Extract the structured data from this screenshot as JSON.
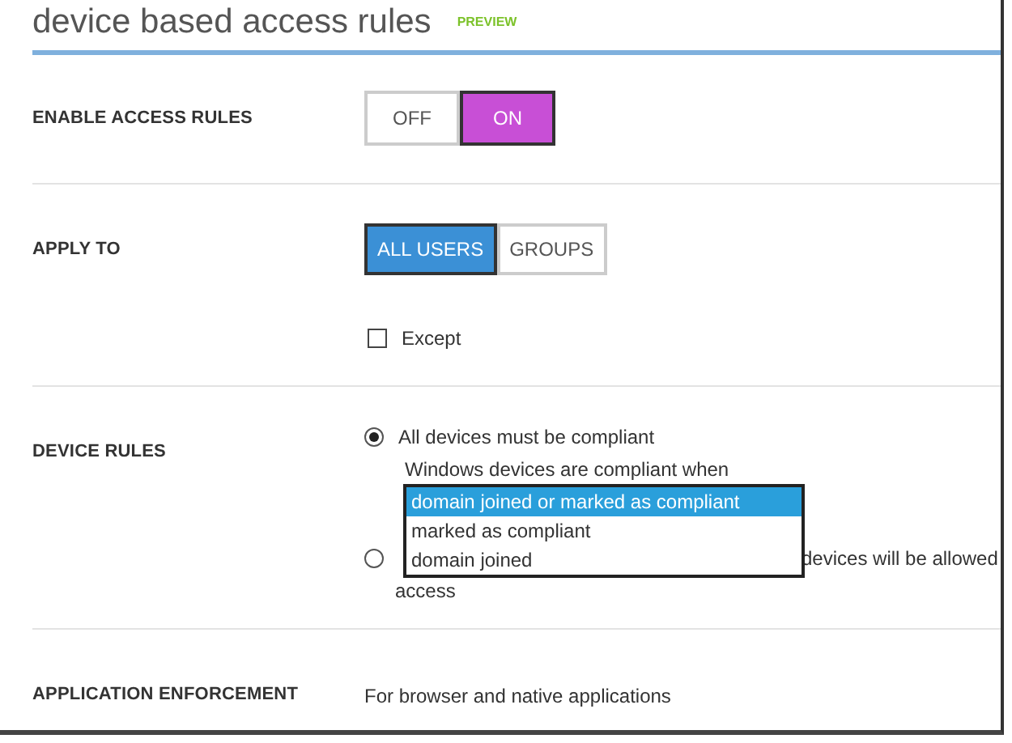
{
  "header": {
    "title": "device based access rules",
    "badge": "PREVIEW"
  },
  "sections": [
    {
      "kind": "toggle",
      "label": "ENABLE ACCESS RULES",
      "options": [
        {
          "label": "OFF",
          "selected": false
        },
        {
          "label": "ON",
          "selected": true
        }
      ]
    },
    {
      "kind": "segmented",
      "label": "APPLY TO",
      "options": [
        {
          "label": "ALL USERS",
          "selected": true
        },
        {
          "label": "GROUPS",
          "selected": false
        }
      ],
      "except": {
        "label": "Except",
        "checked": false
      }
    },
    {
      "kind": "radios",
      "label": "DEVICE RULES",
      "radios": [
        {
          "label": "All devices must be compliant",
          "selected": true,
          "sublabel": "Windows devices are compliant when",
          "dropdown": {
            "options": [
              {
                "label": "domain joined or marked as compliant",
                "selected": true
              },
              {
                "label": "marked as compliant",
                "selected": false
              },
              {
                "label": "domain joined",
                "selected": false
              }
            ]
          }
        },
        {
          "label_fragments": [
            "devices will be allowed",
            "access"
          ],
          "selected": false
        }
      ]
    },
    {
      "kind": "text",
      "label": "APPLICATION ENFORCEMENT",
      "text": "For browser and native applications"
    }
  ]
}
